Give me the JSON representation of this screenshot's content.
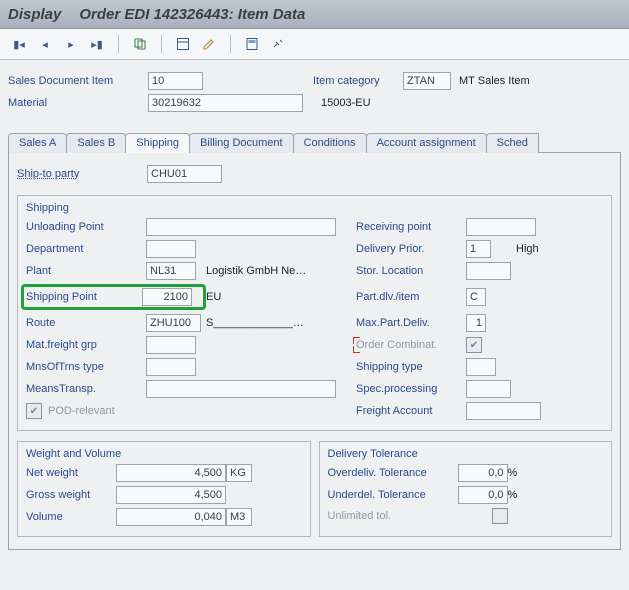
{
  "title": {
    "display": "Display",
    "order": "Order EDI 142326443: Item Data"
  },
  "header": {
    "sales_doc_item_lbl": "Sales Document Item",
    "sales_doc_item": "10",
    "item_cat_lbl": "Item category",
    "item_cat": "ZTAN",
    "item_cat_desc": "MT Sales Item",
    "material_lbl": "Material",
    "material": "30219632",
    "material_desc": "15003-EU"
  },
  "tabs": {
    "sales_a": "Sales A",
    "sales_b": "Sales B",
    "shipping": "Shipping",
    "billing": "Billing Document",
    "conditions": "Conditions",
    "acct_assign": "Account assignment",
    "sched": "Sched"
  },
  "ship_to_lbl": "Ship-to party",
  "ship_to": "CHU01",
  "shipping_box": {
    "title": "Shipping",
    "unloading_lbl": "Unloading Point",
    "unloading": "",
    "receiving_lbl": "Receiving point",
    "receiving": "",
    "department_lbl": "Department",
    "department": "",
    "deliv_prior_lbl": "Delivery Prior.",
    "deliv_prior": "1",
    "deliv_prior_txt": "High",
    "plant_lbl": "Plant",
    "plant": "NL31",
    "plant_desc": "Logistik GmbH Ne…",
    "stor_loc_lbl": "Stor. Location",
    "stor_loc": "",
    "ship_point_lbl": "Shipping Point",
    "ship_point": "2100",
    "ship_point_desc": "EU",
    "part_dlv_lbl": "Part.dlv./item",
    "part_dlv": "C",
    "route_lbl": "Route",
    "route": "ZHU100",
    "route_desc": "S_____________…",
    "max_part_lbl": "Max.Part.Deliv.",
    "max_part": "1",
    "mat_freight_lbl": "Mat.freight grp",
    "mat_freight": "",
    "order_comb_lbl": "Order Combinat.",
    "mns_trns_lbl": "MnsOfTrns type",
    "mns_trns": "",
    "ship_type_lbl": "Shipping type",
    "ship_type": "",
    "means_transp_lbl": "MeansTransp.",
    "means_transp": "",
    "spec_proc_lbl": "Spec.processing",
    "spec_proc": "",
    "pod_lbl": "POD-relevant",
    "freight_acc_lbl": "Freight Account",
    "freight_acc": ""
  },
  "wv_box": {
    "title": "Weight and Volume",
    "net_lbl": "Net weight",
    "net": "4,500",
    "net_u": "KG",
    "gross_lbl": "Gross weight",
    "gross": "4,500",
    "vol_lbl": "Volume",
    "vol": "0,040",
    "vol_u": "M3"
  },
  "dt_box": {
    "title": "Delivery Tolerance",
    "over_lbl": "Overdeliv. Tolerance",
    "over": "0,0",
    "pct": "%",
    "under_lbl": "Underdel. Tolerance",
    "under": "0,0",
    "unl_lbl": "Unlimited tol."
  }
}
